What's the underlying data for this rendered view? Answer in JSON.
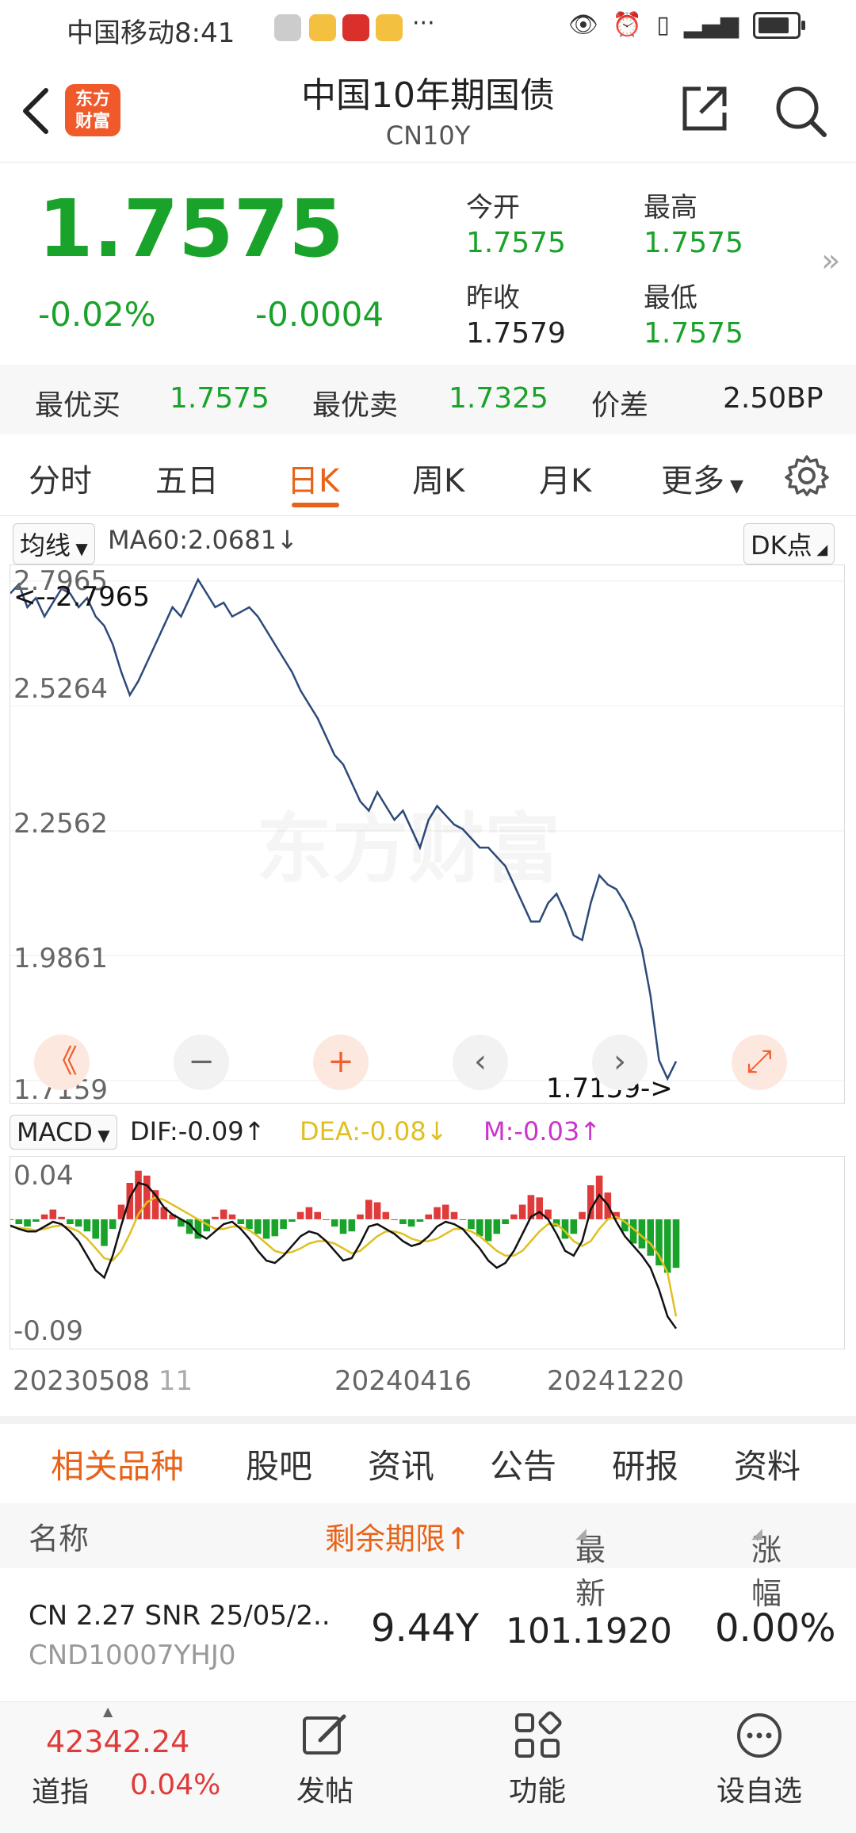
{
  "status_bar": {
    "carrier": "中国移动",
    "time": "8:41",
    "more": "···"
  },
  "header": {
    "logo_line1": "东方",
    "logo_line2": "财富",
    "title": "中国10年期国债",
    "subtitle": "CN10Y"
  },
  "quote": {
    "price": "1.7575",
    "change_pct": "-0.02%",
    "change_val": "-0.0004",
    "open_label": "今开",
    "open": "1.7575",
    "high_label": "最高",
    "high": "1.7575",
    "prev_close_label": "昨收",
    "prev_close": "1.7579",
    "low_label": "最低",
    "low": "1.7575"
  },
  "bid_ask": {
    "bid_label": "最优买",
    "bid": "1.7575",
    "ask_label": "最优卖",
    "ask": "1.7325",
    "spread_label": "价差",
    "spread": "2.50BP"
  },
  "period_tabs": [
    "分时",
    "五日",
    "日K",
    "周K",
    "月K",
    "更多"
  ],
  "active_period": "日K",
  "chart_header": {
    "ma_select": "均线",
    "ma_text": "MA60:2.0681↓",
    "dk_button": "DK点"
  },
  "chart_data": {
    "type": "line",
    "y_ticks": [
      "2.7965",
      "2.5264",
      "2.2562",
      "1.9861",
      "1.7159"
    ],
    "ylim": [
      1.7159,
      2.7965
    ],
    "max_label": "<--2.7965",
    "min_label": "1.7159->",
    "watermark": "东方财富",
    "x_ticks": [
      "20230508",
      "20240416",
      "20241220"
    ],
    "x_tick_extra": "11",
    "values": [
      2.77,
      2.79,
      2.74,
      2.76,
      2.72,
      2.75,
      2.78,
      2.77,
      2.74,
      2.76,
      2.72,
      2.7,
      2.66,
      2.6,
      2.55,
      2.58,
      2.62,
      2.66,
      2.7,
      2.74,
      2.72,
      2.76,
      2.8,
      2.77,
      2.74,
      2.75,
      2.72,
      2.73,
      2.74,
      2.72,
      2.69,
      2.66,
      2.63,
      2.6,
      2.56,
      2.53,
      2.5,
      2.46,
      2.42,
      2.4,
      2.36,
      2.32,
      2.3,
      2.34,
      2.31,
      2.28,
      2.3,
      2.26,
      2.22,
      2.28,
      2.31,
      2.29,
      2.27,
      2.26,
      2.24,
      2.22,
      2.22,
      2.2,
      2.18,
      2.14,
      2.1,
      2.06,
      2.06,
      2.1,
      2.12,
      2.08,
      2.03,
      2.02,
      2.1,
      2.16,
      2.14,
      2.13,
      2.1,
      2.06,
      2.0,
      1.9,
      1.76,
      1.72,
      1.7575
    ],
    "macd": {
      "dif": "DIF:-0.09↑",
      "dea": "DEA:-0.08↓",
      "m": "M:-0.03↑",
      "select": "MACD",
      "y_ticks": [
        "0.04",
        "-0.09"
      ],
      "ylim": [
        -0.1,
        0.045
      ],
      "hist": [
        0.0,
        -0.004,
        -0.006,
        -0.002,
        0.004,
        0.008,
        0.002,
        -0.004,
        -0.006,
        -0.01,
        -0.016,
        -0.022,
        -0.008,
        0.012,
        0.03,
        0.04,
        0.036,
        0.024,
        0.01,
        0.004,
        -0.006,
        -0.012,
        -0.016,
        -0.01,
        0.002,
        0.008,
        0.004,
        -0.004,
        -0.008,
        -0.012,
        -0.016,
        -0.014,
        -0.008,
        -0.002,
        0.006,
        0.01,
        0.006,
        0.0,
        -0.006,
        -0.012,
        -0.01,
        0.004,
        0.016,
        0.014,
        0.006,
        0.0,
        -0.004,
        -0.006,
        -0.002,
        0.004,
        0.01,
        0.012,
        0.006,
        0.0,
        -0.008,
        -0.014,
        -0.018,
        -0.012,
        -0.004,
        0.004,
        0.012,
        0.02,
        0.018,
        0.008,
        -0.006,
        -0.016,
        -0.012,
        0.006,
        0.028,
        0.036,
        0.022,
        0.006,
        -0.01,
        -0.02,
        -0.024,
        -0.03,
        -0.038,
        -0.044,
        -0.04
      ],
      "dif_line": [
        -0.005,
        -0.008,
        -0.01,
        -0.01,
        -0.006,
        -0.002,
        -0.004,
        -0.01,
        -0.018,
        -0.03,
        -0.042,
        -0.048,
        -0.03,
        -0.005,
        0.018,
        0.03,
        0.028,
        0.02,
        0.01,
        0.004,
        0.0,
        -0.004,
        -0.012,
        -0.016,
        -0.01,
        -0.004,
        -0.002,
        -0.008,
        -0.016,
        -0.026,
        -0.034,
        -0.036,
        -0.03,
        -0.022,
        -0.014,
        -0.01,
        -0.012,
        -0.018,
        -0.026,
        -0.034,
        -0.032,
        -0.02,
        -0.006,
        -0.004,
        -0.008,
        -0.012,
        -0.018,
        -0.022,
        -0.02,
        -0.014,
        -0.006,
        -0.002,
        -0.004,
        -0.008,
        -0.016,
        -0.024,
        -0.034,
        -0.04,
        -0.036,
        -0.026,
        -0.012,
        0.002,
        0.006,
        0.0,
        -0.012,
        -0.026,
        -0.03,
        -0.018,
        0.008,
        0.02,
        0.012,
        -0.002,
        -0.014,
        -0.022,
        -0.03,
        -0.04,
        -0.058,
        -0.08,
        -0.09
      ],
      "dea_line": [
        -0.006,
        -0.007,
        -0.008,
        -0.009,
        -0.008,
        -0.006,
        -0.005,
        -0.007,
        -0.01,
        -0.016,
        -0.024,
        -0.032,
        -0.034,
        -0.026,
        -0.012,
        0.004,
        0.014,
        0.018,
        0.016,
        0.012,
        0.008,
        0.004,
        0.0,
        -0.004,
        -0.008,
        -0.008,
        -0.006,
        -0.006,
        -0.009,
        -0.014,
        -0.02,
        -0.026,
        -0.028,
        -0.027,
        -0.024,
        -0.02,
        -0.018,
        -0.018,
        -0.02,
        -0.024,
        -0.028,
        -0.026,
        -0.02,
        -0.014,
        -0.01,
        -0.01,
        -0.012,
        -0.016,
        -0.018,
        -0.018,
        -0.016,
        -0.012,
        -0.008,
        -0.008,
        -0.01,
        -0.014,
        -0.02,
        -0.026,
        -0.03,
        -0.03,
        -0.026,
        -0.018,
        -0.01,
        -0.004,
        -0.004,
        -0.01,
        -0.018,
        -0.022,
        -0.018,
        -0.008,
        0.0,
        0.002,
        -0.002,
        -0.008,
        -0.014,
        -0.02,
        -0.03,
        -0.044,
        -0.08
      ]
    }
  },
  "chart_nav": {
    "first": "《",
    "zoom_out": "−",
    "zoom_in": "+",
    "prev": "‹",
    "next": "›",
    "expand": "⤢"
  },
  "bottom_tabs": [
    "相关品种",
    "股吧",
    "资讯",
    "公告",
    "研报",
    "资料"
  ],
  "active_bottom_tab": "相关品种",
  "table": {
    "headers": {
      "name": "名称",
      "term": "剩余期限↑",
      "latest": "最新",
      "change": "涨幅"
    },
    "rows": [
      {
        "name": "CN 2.27 SNR 25/05/2..",
        "code": "CND10007YHJ0",
        "term": "9.44Y",
        "latest": "101.1920",
        "change": "0.00%"
      }
    ]
  },
  "bottom_bar": {
    "index_value": "42342.24",
    "index_label": "道指",
    "index_change": "0.04%",
    "post": "发帖",
    "functions": "功能",
    "watchlist": "设自选"
  },
  "colors": {
    "up": "#e03b3b",
    "down": "#19a32a",
    "accent": "#e8631a",
    "line": "#2c4a7a",
    "dea": "#e0c020",
    "m": "#cc33cc"
  }
}
